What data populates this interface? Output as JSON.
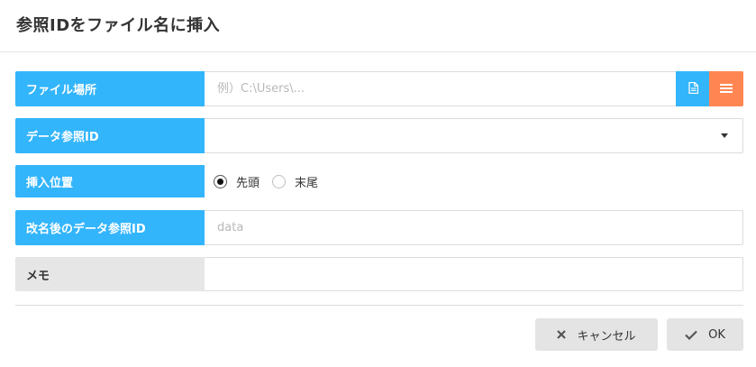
{
  "dialog": {
    "title": "参照IDをファイル名に挿入"
  },
  "form": {
    "file_location": {
      "label": "ファイル場所",
      "placeholder": "例）C:\\Users\\...",
      "value": ""
    },
    "data_ref_id": {
      "label": "データ参照ID",
      "selected": ""
    },
    "insert_position": {
      "label": "挿入位置",
      "options": [
        {
          "label": "先頭",
          "checked": true
        },
        {
          "label": "末尾",
          "checked": false
        }
      ]
    },
    "renamed_data_ref_id": {
      "label": "改名後のデータ参照ID",
      "placeholder": "data",
      "value": ""
    },
    "memo": {
      "label": "メモ",
      "value": ""
    }
  },
  "footer": {
    "cancel_label": "キャンセル",
    "ok_label": "OK"
  },
  "colors": {
    "label_blue": "#33b5fc",
    "list_button_orange": "#ff8652",
    "memo_label_gray": "#e6e6e6",
    "button_gray": "#e4e4e4"
  },
  "icons": {
    "file_button": "file-icon",
    "list_button": "list-icon",
    "dropdown": "caret-down-icon",
    "cancel": "close-icon",
    "ok": "checkmark-icon"
  }
}
